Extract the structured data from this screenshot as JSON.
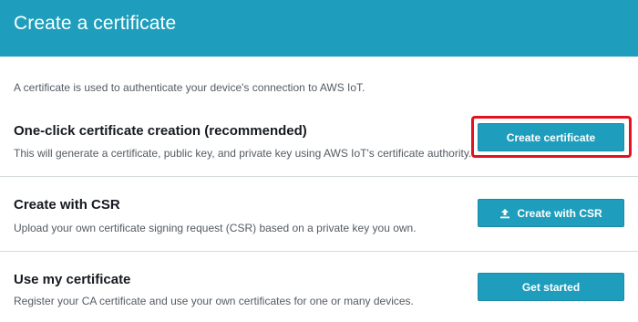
{
  "header": {
    "title": "Create a certificate"
  },
  "intro": {
    "text": "A certificate is used to authenticate your device's connection to AWS IoT."
  },
  "sections": [
    {
      "title": "One-click certificate creation (recommended)",
      "description": "This will generate a certificate, public key, and private key using AWS IoT's certificate authority.",
      "button_label": "Create certificate",
      "highlighted": true
    },
    {
      "title": "Create with CSR",
      "description": "Upload your own certificate signing request (CSR) based on a private key you own.",
      "button_label": "Create with CSR",
      "button_icon": "upload-icon"
    },
    {
      "title": "Use my certificate",
      "description": "Register your CA certificate and use your own certificates for one or many devices.",
      "button_label": "Get started"
    }
  ],
  "colors": {
    "header_bg": "#1e9ebc",
    "button_bg": "#1e9ebc",
    "highlight": "#e3121f"
  }
}
